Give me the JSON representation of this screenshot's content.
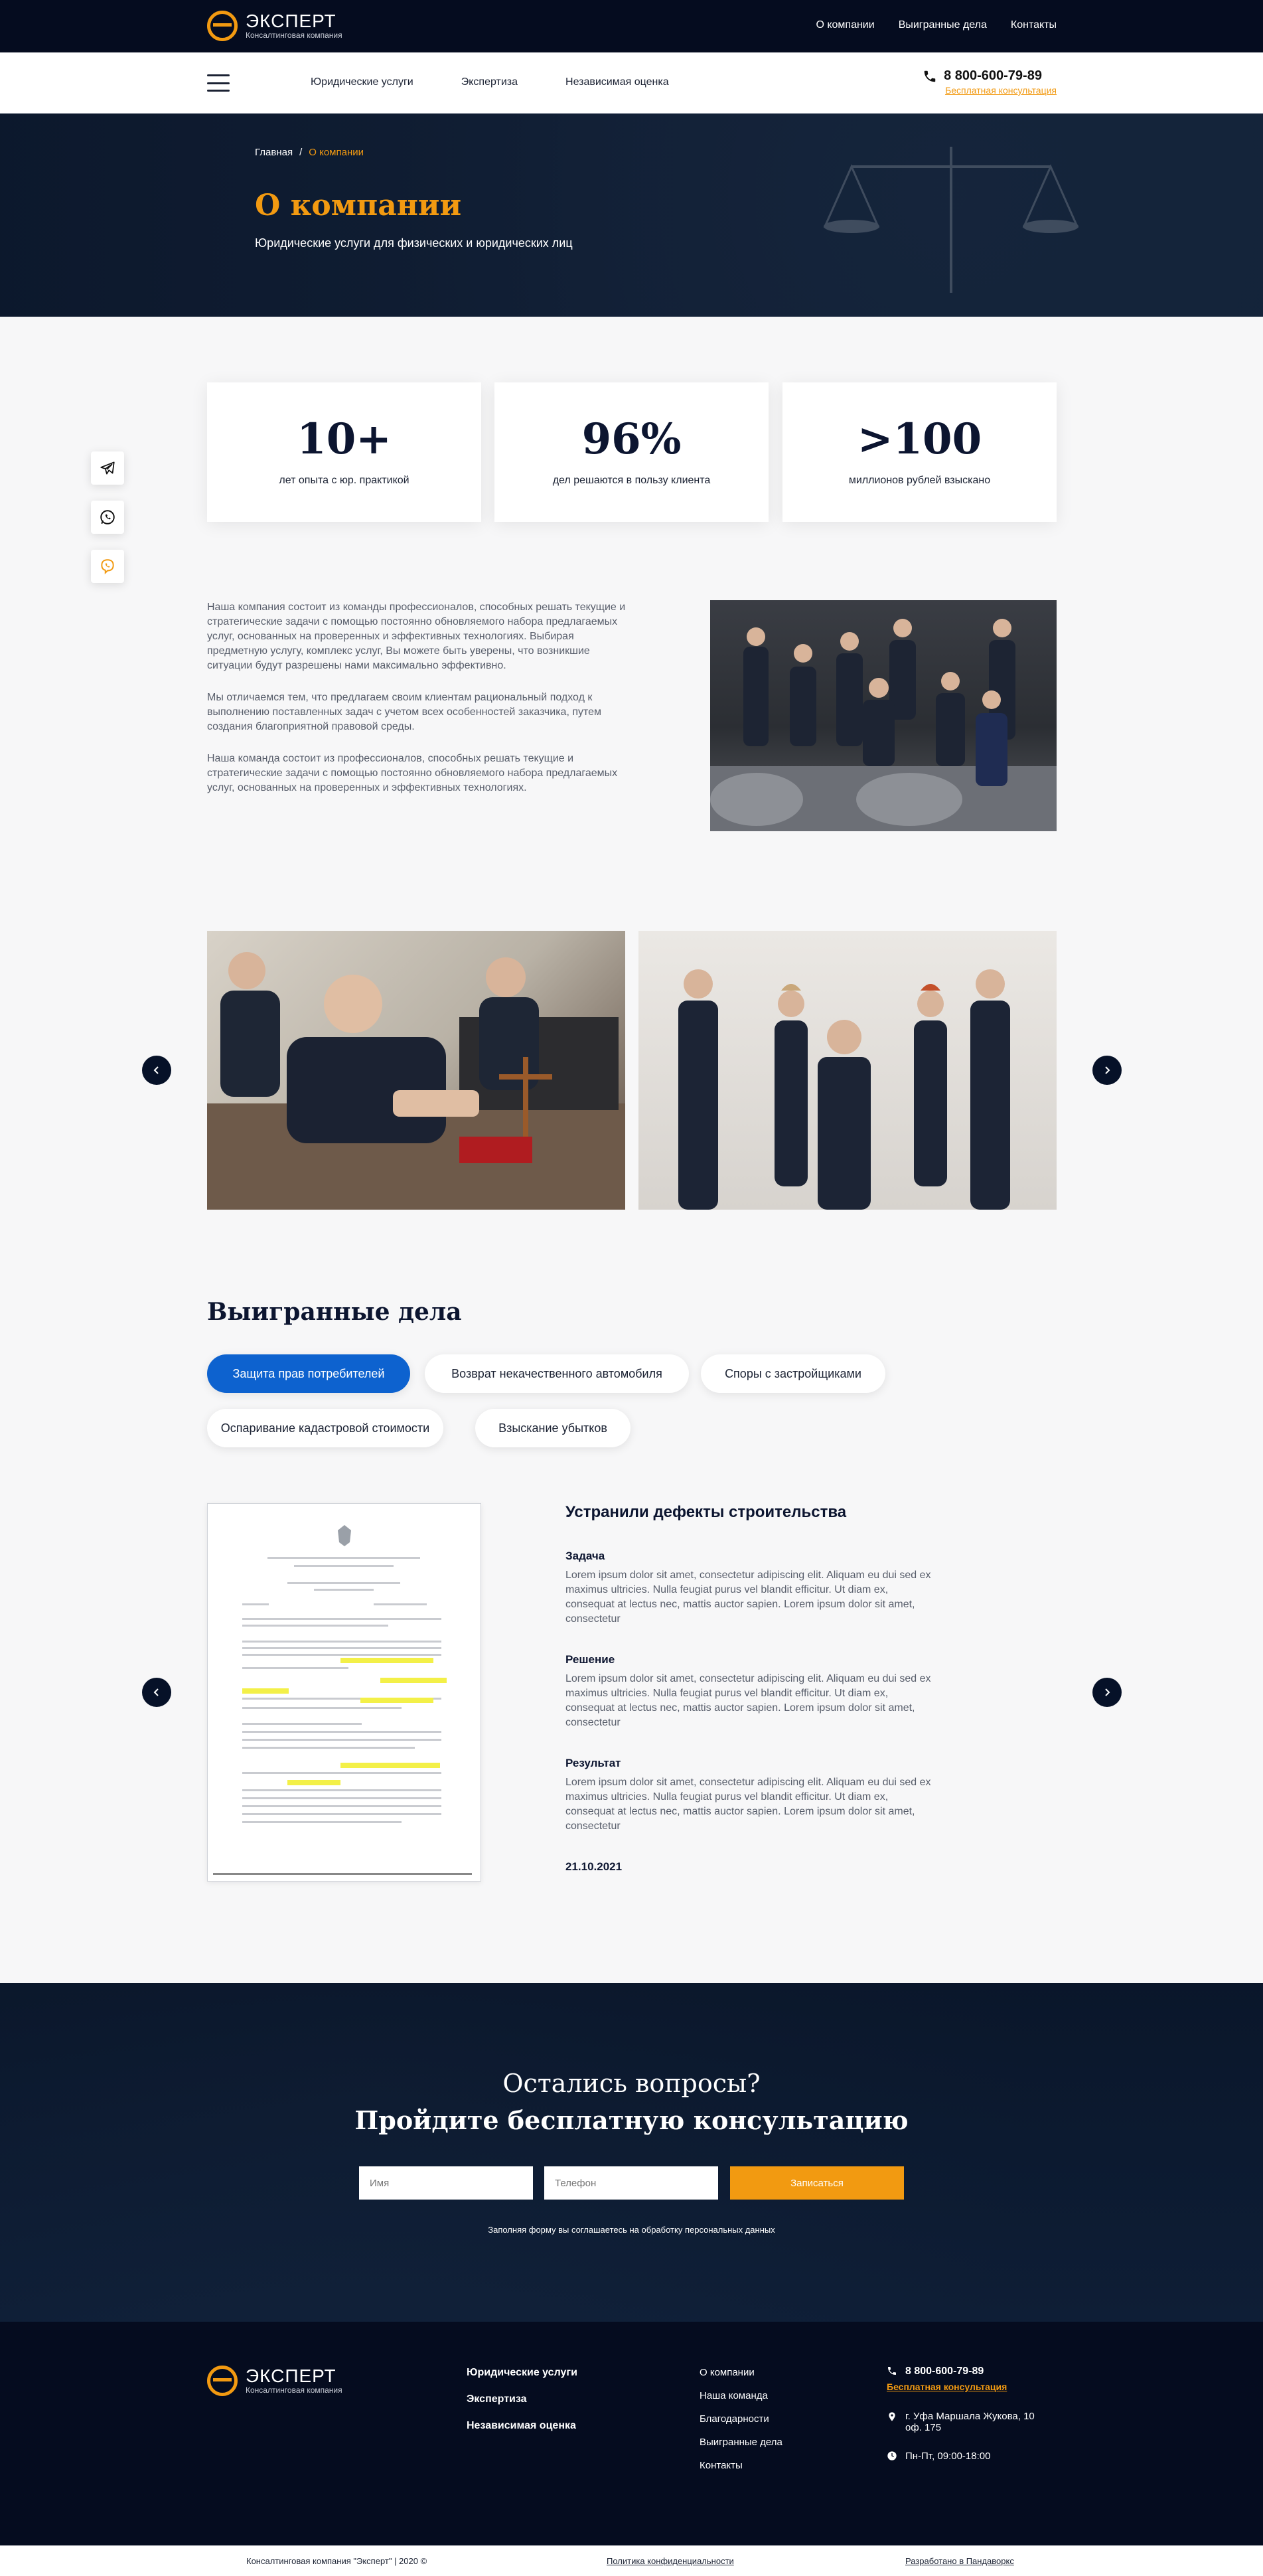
{
  "brand": {
    "name": "ЭКСПЕРТ",
    "tagline": "Консалтинговая компания"
  },
  "topnav": [
    "О компании",
    "Выигранные дела",
    "Контакты"
  ],
  "mainnav": [
    "Юридические услуги",
    "Экспертиза",
    "Независимая оценка"
  ],
  "contact": {
    "phone": "8 800-600-79-89",
    "cta": "Бесплатная консультация"
  },
  "hero": {
    "breadcrumb": {
      "home": "Главная",
      "separator": "/",
      "current": "О компании"
    },
    "title": "О компании",
    "subtitle": "Юридические услуги для физических и юридических лиц"
  },
  "social": [
    "telegram-icon",
    "whatsapp-icon",
    "viber-icon"
  ],
  "stats": [
    {
      "value": "10+",
      "label": "лет опыта с юр. практикой"
    },
    {
      "value": "96%",
      "label": "дел решаются в пользу клиента"
    },
    {
      "value": ">100",
      "label": "миллионов рублей взыскано"
    }
  ],
  "about": [
    "Наша компания состоит из команды профессионалов, способных решать текущие и стратегические задачи с помощью постоянно обновляемого набора предлагаемых услуг, основанных на проверенных и эффективных технологиях. Выбирая предметную услугу, комплекс услуг, Вы можете быть уверены, что возникшие ситуации будут разрешены нами максимально эффективно.",
    "Мы отличаемся тем, что предлагаем своим клиентам рациональный подход к выполнению поставленных задач с учетом всех особенностей заказчика, путем создания благоприятной правовой среды.",
    "Наша команда состоит из профессионалов, способных решать текущие и стратегические задачи с помощью постоянно обновляемого набора предлагаемых услуг, основанных на проверенных и эффективных технологиях."
  ],
  "cases": {
    "title": "Выигранные дела",
    "tabs": [
      "Защита прав потребителей",
      "Возврат некачественного автомобиля",
      "Споры с застройщиками",
      "Оспаривание кадастровой стоимости",
      "Взыскание убытков"
    ],
    "active_tab": "Защита прав потребителей",
    "item": {
      "heading": "Устранили дефекты строительства",
      "task_label": "Задача",
      "task": "Lorem ipsum dolor sit amet, consectetur adipiscing elit. Aliquam eu dui sed ex maximus ultricies. Nulla feugiat purus vel blandit efficitur. Ut diam ex, consequat at lectus nec, mattis auctor sapien. Lorem ipsum dolor sit amet, consectetur",
      "solution_label": "Решение",
      "solution": "Lorem ipsum dolor sit amet, consectetur adipiscing elit. Aliquam eu dui sed ex maximus ultricies. Nulla feugiat purus vel blandit efficitur. Ut diam ex, consequat at lectus nec, mattis auctor sapien. Lorem ipsum dolor sit amet, consectetur",
      "result_label": "Результат",
      "result": "Lorem ipsum dolor sit amet, consectetur adipiscing elit. Aliquam eu dui sed ex maximus ultricies. Nulla feugiat purus vel blandit efficitur. Ut diam ex, consequat at lectus nec, mattis auctor sapien. Lorem ipsum dolor sit amet, consectetur",
      "date": "21.10.2021"
    }
  },
  "consult": {
    "line1": "Остались вопросы?",
    "line2": "Пройдите бесплатную консультацию",
    "name_placeholder": "Имя",
    "phone_placeholder": "Телефон",
    "submit": "Записаться",
    "agreement": "Заполняя форму вы соглашаетесь на обработку персональных данных"
  },
  "footer": {
    "services": [
      "Юридические услуги",
      "Экспертиза",
      "Независимая оценка"
    ],
    "links": [
      "О компании",
      "Наша команда",
      "Благодарности",
      "Выигранные дела",
      "Контакты"
    ],
    "phone": "8 800-600-79-89",
    "cta": "Бесплатная консультация",
    "address": "г. Уфа Маршала Жукова, 10 оф. 175",
    "hours": "Пн-Пт, 09:00-18:00",
    "copyright": "Консалтинговая компания \"Эксперт\" | 2020 ©",
    "privacy": "Политика конфиденциальности",
    "developer": "Разработано в Пандаворкс"
  },
  "colors": {
    "accent": "#f29a11",
    "navy": "#050c1f",
    "active_tab": "#0d62cf"
  }
}
